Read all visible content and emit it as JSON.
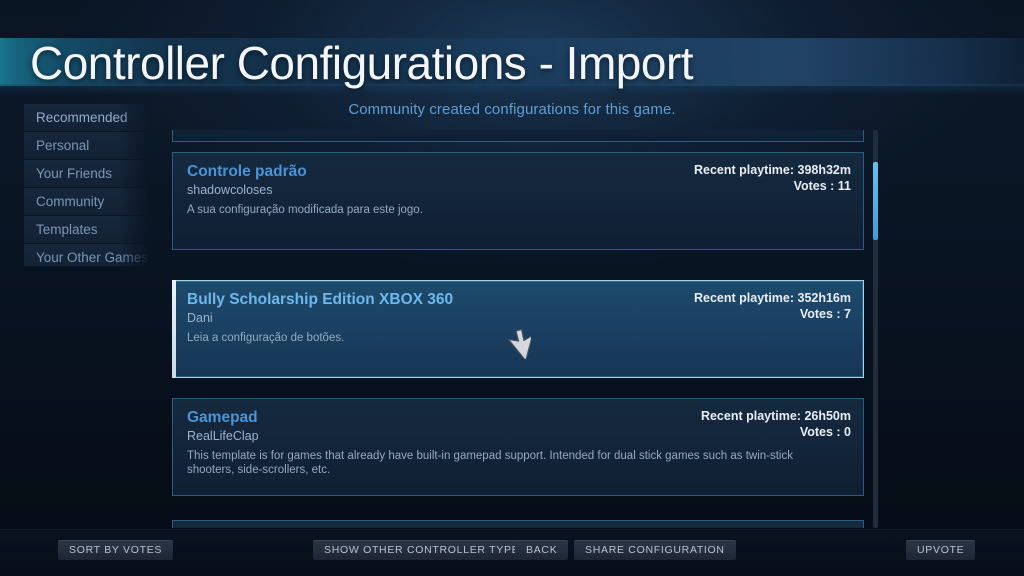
{
  "header": {
    "title": "Controller Configurations - Import",
    "subtitle": "Community created configurations for this game."
  },
  "sidebar": {
    "items": [
      {
        "label": "Recommended",
        "active": true
      },
      {
        "label": "Personal",
        "active": false
      },
      {
        "label": "Your Friends",
        "active": false
      },
      {
        "label": "Community",
        "active": false
      },
      {
        "label": "Templates",
        "active": false
      },
      {
        "label": "Your Other Games",
        "active": false
      }
    ]
  },
  "list": {
    "playtime_prefix": "Recent playtime: ",
    "votes_prefix": "Votes : ",
    "rows": [
      {
        "name": "Controle padrão",
        "author": "shadowcoloses",
        "description": "A sua configuração modificada para este jogo.",
        "playtime": "Recent playtime: 398h32m",
        "votes": "Votes : 11",
        "selected": false
      },
      {
        "name": "Bully Scholarship Edition XBOX 360",
        "author": "Dani",
        "description": "Leia a configuração de botões.",
        "playtime": "Recent playtime: 352h16m",
        "votes": "Votes : 7",
        "selected": true
      },
      {
        "name": "Gamepad",
        "author": "RealLifeClap",
        "description": "This template is for games that already have built-in gamepad support.  Intended for dual stick games such as twin-stick shooters, side-scrollers, etc.",
        "playtime": "Recent playtime: 26h50m",
        "votes": "Votes : 0",
        "selected": false
      }
    ]
  },
  "toolbar": {
    "sort_by_votes": "SORT BY VOTES",
    "show_other_controller_types": "SHOW OTHER CONTROLLER TYPES",
    "back": "BACK",
    "share_configuration": "SHARE CONFIGURATION",
    "upvote": "UPVOTE"
  },
  "colors": {
    "accent_blue": "#4a94d8",
    "selection_border": "#9fd4e8",
    "scrollbar_thumb": "#63c2f0",
    "subtitle": "#5f9ed4"
  }
}
